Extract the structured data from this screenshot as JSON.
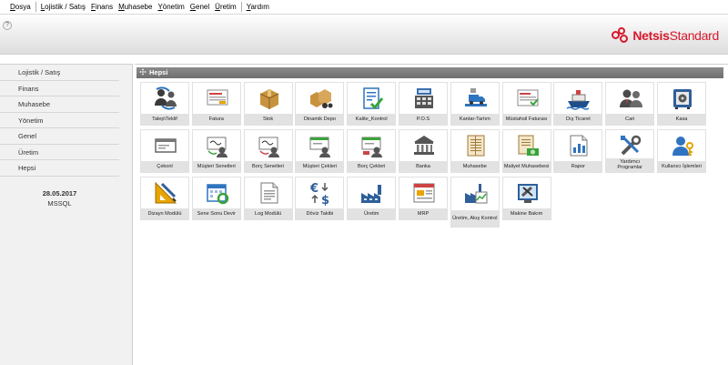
{
  "menu": [
    "Dosya",
    "Lojistik / Satış",
    "Finans",
    "Muhasebe",
    "Yönetim",
    "Genel",
    "Üretim",
    "Yardım"
  ],
  "header": {
    "help": "?",
    "brand_bold": "Netsis",
    "brand_rest": "Standard"
  },
  "sidebar": {
    "items": [
      "Lojistik / Satış",
      "Finans",
      "Muhasebe",
      "Yönetim",
      "Genel",
      "Üretim",
      "Hepsi"
    ],
    "date": "28.05.2017",
    "db": "MSSQL"
  },
  "panel": {
    "title": "Hepsi"
  },
  "tiles": [
    {
      "label": "Talep\\Teklif",
      "icon": "request-offer-icon"
    },
    {
      "label": "Fatura",
      "icon": "invoice-icon"
    },
    {
      "label": "Stok",
      "icon": "stock-box-icon"
    },
    {
      "label": "Dinamik Depo",
      "icon": "dynamic-warehouse-icon"
    },
    {
      "label": "Kalite_Kontrol",
      "icon": "quality-control-icon"
    },
    {
      "label": "P.O.S",
      "icon": "pos-register-icon"
    },
    {
      "label": "Kantar-Tartım",
      "icon": "weighbridge-icon"
    },
    {
      "label": "Müstahsil Faturası",
      "icon": "producer-invoice-icon"
    },
    {
      "label": "Dış Ticaret",
      "icon": "ship-icon"
    },
    {
      "label": "Cari",
      "icon": "accounts-people-icon"
    },
    {
      "label": "Kasa",
      "icon": "safe-icon"
    },
    {
      "label": "Çekonl",
      "icon": "check-icon"
    },
    {
      "label": "Müşteri Senetleri",
      "icon": "customer-notes-icon"
    },
    {
      "label": "Borç Senetleri",
      "icon": "debt-notes-icon"
    },
    {
      "label": "Müşteri Çekleri",
      "icon": "customer-checks-icon"
    },
    {
      "label": "Borç Çekleri",
      "icon": "debt-checks-icon"
    },
    {
      "label": "Banka",
      "icon": "bank-icon"
    },
    {
      "label": "Muhasebe",
      "icon": "ledger-icon"
    },
    {
      "label": "Maliyet Muhasebesi",
      "icon": "cost-accounting-icon"
    },
    {
      "label": "Rapor",
      "icon": "report-icon"
    },
    {
      "label": "Yardımcı Programlar",
      "icon": "tools-icon"
    },
    {
      "label": "Kullanıcı İşlemleri",
      "icon": "user-key-icon"
    },
    {
      "label": "Dizayn Modülü",
      "icon": "design-ruler-icon"
    },
    {
      "label": "Sene Sonu Devir",
      "icon": "calendar-refresh-icon"
    },
    {
      "label": "Log Modülü",
      "icon": "log-document-icon"
    },
    {
      "label": "Döviz Takibi",
      "icon": "currency-exchange-icon"
    },
    {
      "label": "Üretim",
      "icon": "factory-icon"
    },
    {
      "label": "MRP",
      "icon": "mrp-window-icon"
    },
    {
      "label": "Üretim, Akış Kontrol",
      "icon": "production-flow-icon"
    },
    {
      "label": "Makine Bakım",
      "icon": "machine-maintenance-icon"
    }
  ],
  "colors": {
    "brand_red": "#d9182d",
    "panel_header": "#7b7b7b",
    "sidebar_bg": "#f1f1f1",
    "tile_label_bg": "#e2e2e2"
  }
}
